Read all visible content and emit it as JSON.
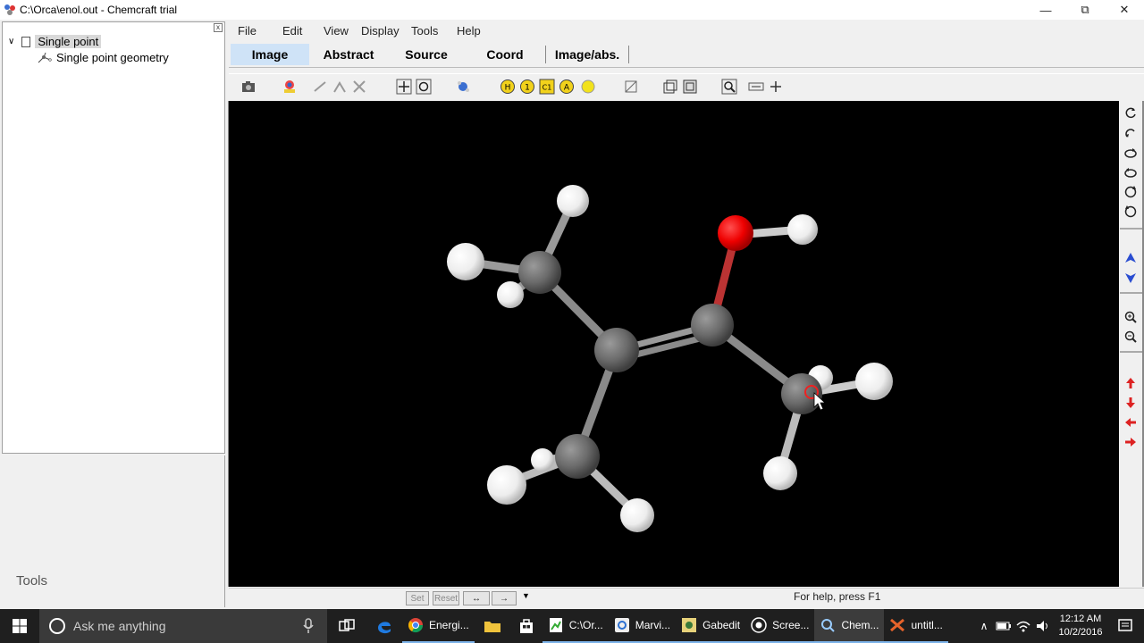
{
  "window": {
    "title": "C:\\Orca\\enol.out - Chemcraft trial",
    "controls": [
      "minimize",
      "restore",
      "close"
    ]
  },
  "tree": {
    "root_label": "Single point",
    "child_label": "Single point geometry"
  },
  "left_panel": {
    "tools_label": "Tools"
  },
  "menu": [
    "File",
    "Edit",
    "View",
    "Display",
    "Tools",
    "Help"
  ],
  "tabs": [
    "Image",
    "Abstract",
    "Source",
    "Coord",
    "Image/abs."
  ],
  "active_tab": "Image",
  "toolbar": {
    "atom_labels": [
      "H",
      "1",
      "C1",
      "A",
      ""
    ]
  },
  "status": {
    "help_text": "For help, press F1",
    "buttons": [
      "Set",
      "Reset"
    ]
  },
  "taskbar": {
    "search_placeholder": "Ask me anything",
    "apps": [
      {
        "label": "Energi...",
        "icon": "chrome-icon"
      },
      {
        "label": "C:\\Or...",
        "icon": "orca-output-icon"
      },
      {
        "label": "Marvi...",
        "icon": "marvin-icon"
      },
      {
        "label": "Gabedit",
        "icon": "gabedit-icon"
      },
      {
        "label": "Scree...",
        "icon": "screen-recorder-icon"
      },
      {
        "label": "Chem...",
        "icon": "chemcraft-icon"
      },
      {
        "label": "untitl...",
        "icon": "untitled-app-icon"
      }
    ],
    "clock_time": "12:12 AM",
    "clock_date": "10/2/2016"
  },
  "colors": {
    "viewport_bg": "#000000",
    "carbon": "#6e6e6e",
    "oxygen": "#ff1010",
    "hydrogen": "#f2f2f2",
    "active_tab_bg": "#cfe3f7",
    "taskbar_bg": "#1f1f1f"
  }
}
